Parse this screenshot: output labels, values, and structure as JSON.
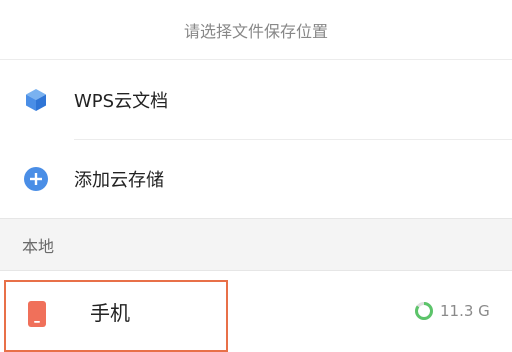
{
  "header": {
    "title": "请选择文件保存位置"
  },
  "items": [
    {
      "label": "WPS云文档",
      "icon": "cube-icon",
      "color": "#4a8ee6"
    },
    {
      "label": "添加云存储",
      "icon": "plus-circle-icon",
      "color": "#4a8ee6"
    }
  ],
  "section": {
    "title": "本地"
  },
  "local": {
    "label": "手机",
    "icon": "phone-icon",
    "icon_color": "#f0705a",
    "storage_value": "11.3 G",
    "storage_used_fraction": 0.85,
    "highlight_color": "#e87048"
  }
}
